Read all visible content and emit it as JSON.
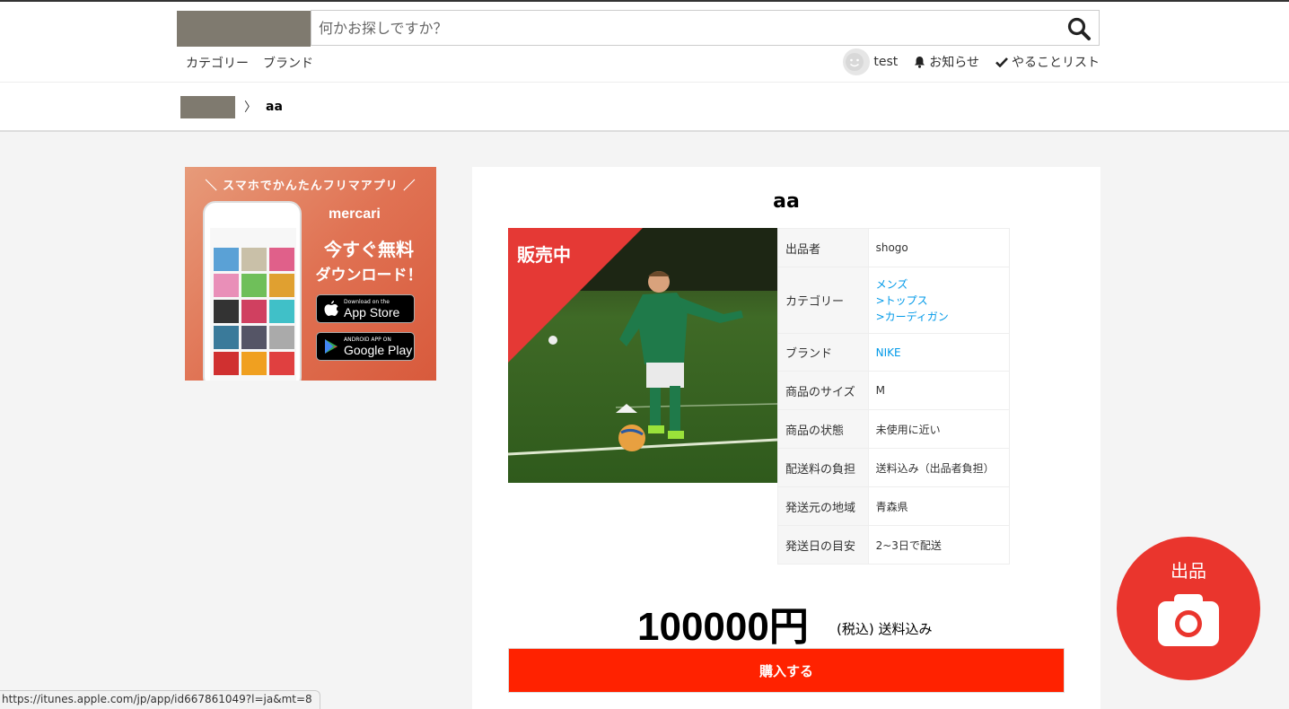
{
  "header": {
    "search_placeholder": "何かお探しですか？",
    "nav_left": [
      "カテゴリー",
      "ブランド"
    ],
    "user_name": "test",
    "notifications_label": "お知らせ",
    "todo_label": "やることリスト"
  },
  "breadcrumb": {
    "separator": "〉",
    "current": "aa"
  },
  "ad": {
    "tagline": "＼ スマホでかんたんフリマアプリ ／",
    "brand": "mercari",
    "headline1": "今すぐ無料",
    "headline2": "ダウンロード！",
    "appstore_small": "Download on the",
    "appstore_big": "App Store",
    "googleplay_small": "ANDROID APP ON",
    "googleplay_big": "Google Play"
  },
  "item": {
    "title": "aa",
    "badge": "販売中",
    "details": {
      "seller_label": "出品者",
      "seller": "shogo",
      "category_label": "カテゴリー",
      "categories": [
        "メンズ",
        ">トップス",
        ">カーディガン"
      ],
      "brand_label": "ブランド",
      "brand": "NIKE",
      "size_label": "商品のサイズ",
      "size": "M",
      "condition_label": "商品の状態",
      "condition": "未使用に近い",
      "shipping_fee_label": "配送料の負担",
      "shipping_fee": "送料込み（出品者負担）",
      "ship_from_label": "発送元の地域",
      "ship_from": "青森県",
      "ship_days_label": "発送日の目安",
      "ship_days": "2~3日で配送"
    },
    "price": "100000円",
    "tax_note": "(税込) 送料込み",
    "buy_label": "購入する"
  },
  "sell_fab": {
    "label": "出品"
  },
  "status_url": "https://itunes.apple.com/jp/app/id667861049?l=ja&mt=8",
  "colors": {
    "accent_red": "#ea352d",
    "buy_red": "#ff2200",
    "link_blue": "#0099e8"
  }
}
